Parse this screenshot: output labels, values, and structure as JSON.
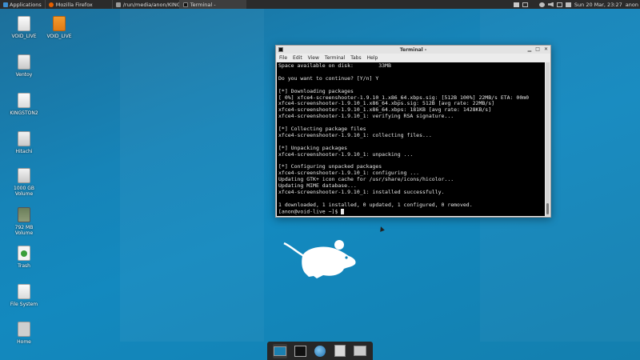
{
  "top_panel": {
    "applications": "Applications",
    "tasks": [
      {
        "label": "Mozilla Firefox",
        "active": false
      },
      {
        "label": "/run/media/anon/KINGS...",
        "active": false
      },
      {
        "label": "Terminal -",
        "active": true
      }
    ],
    "clock": "Sun 20 Mar, 23:27",
    "user": "anon"
  },
  "desktop_icons": [
    {
      "label": "VOID_LIVE"
    },
    {
      "label": "VOID_LIVE"
    },
    {
      "label": "Ventoy"
    },
    {
      "label": "KINGSTON2"
    },
    {
      "label": "Hitachi"
    },
    {
      "label": "1000 GB Volume"
    },
    {
      "label": "792 MB Volume"
    },
    {
      "label": "Trash"
    },
    {
      "label": "File System"
    },
    {
      "label": "Home"
    }
  ],
  "terminal": {
    "title": "Terminal -",
    "menu": [
      "File",
      "Edit",
      "View",
      "Terminal",
      "Tabs",
      "Help"
    ],
    "lines": [
      "Space available on disk:        33MB",
      "",
      "Do you want to continue? [Y/n] Y",
      "",
      "[*] Downloading packages",
      "[ 0%] xfce4-screenshooter-1.9.10_1.x86_64.xbps.sig: [512B 100%] 22MB/s ETA: 00m0",
      "xfce4-screenshooter-1.9.10_1.x86_64.xbps.sig: 512B [avg rate: 22MB/s]",
      "xfce4-screenshooter-1.9.10_1.x86_64.xbps: 181KB [avg rate: 1428KB/s]",
      "xfce4-screenshooter-1.9.10_1: verifying RSA signature...",
      "",
      "[*] Collecting package files",
      "xfce4-screenshooter-1.9.10_1: collecting files...",
      "",
      "[*] Unpacking packages",
      "xfce4-screenshooter-1.9.10_1: unpacking ...",
      "",
      "[*] Configuring unpacked packages",
      "xfce4-screenshooter-1.9.10_1: configuring ...",
      "Updating GTK+ icon cache for /usr/share/icons/hicolor...",
      "Updating MIME database...",
      "xfce4-screenshooter-1.9.10_1: installed successfully.",
      "",
      "1 downloaded, 1 installed, 0 updated, 1 configured, 0 removed."
    ],
    "prompt": "[anon@void-live ~]$ "
  },
  "dock": {
    "items": [
      "show-desktop",
      "terminal",
      "web-browser",
      "app-finder",
      "file-manager"
    ]
  },
  "colors": {
    "panel": "#2b2b2b",
    "desktop": "#1684b8",
    "terminal_bg": "#000000"
  }
}
